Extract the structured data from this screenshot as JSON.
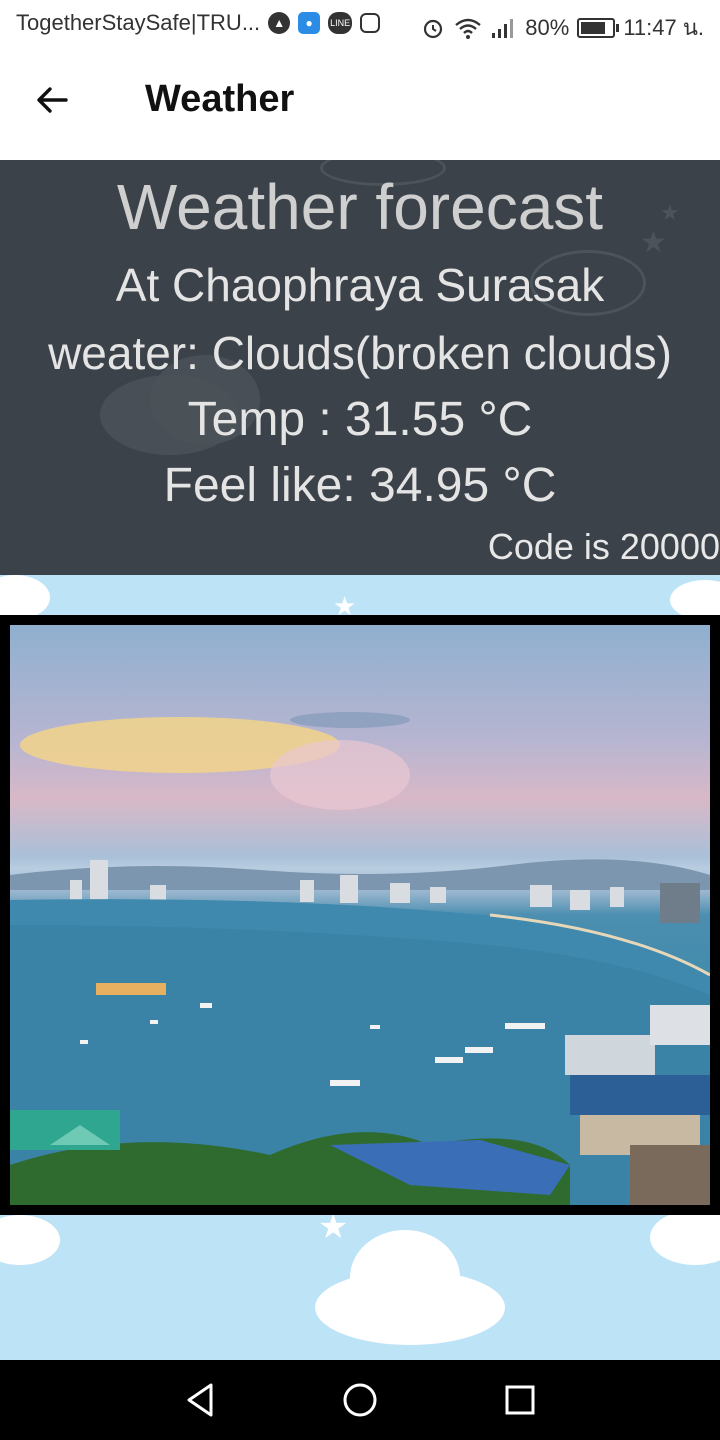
{
  "status_bar": {
    "notification_text": "TogetherStaySafe|TRU...",
    "battery_percent_text": "80%",
    "battery_level": 0.8,
    "time": "11:47 น."
  },
  "app_bar": {
    "title": "Weather"
  },
  "weather": {
    "heading": "Weather forecast",
    "location": "At Chaophraya Surasak",
    "condition": "weater: Clouds(broken clouds)",
    "temperature": "Temp : 31.55 °C",
    "feels_like": "Feel like: 34.95 °C",
    "code": "Code is 20000"
  },
  "icons": {
    "back": "arrow-left-icon",
    "nav_back": "triangle-back-icon",
    "nav_home": "circle-home-icon",
    "nav_recents": "square-recents-icon"
  },
  "colors": {
    "panel_background": "#3b4249",
    "sky_background": "#bde3f7",
    "frame": "#000000"
  }
}
